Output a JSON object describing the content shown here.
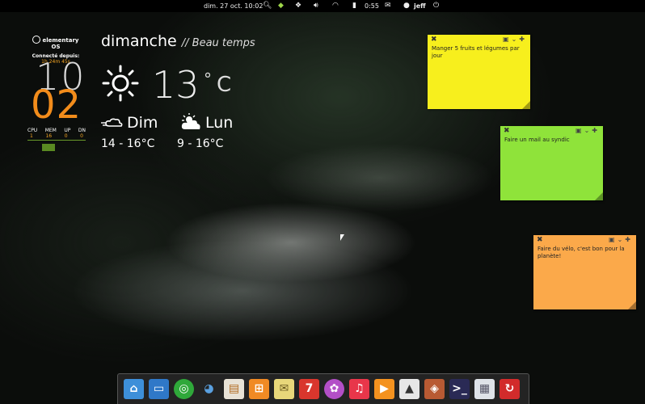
{
  "panel": {
    "datetime": "dim. 27 oct. 10:02",
    "battery_time": "0:55",
    "user": "jeff"
  },
  "conky": {
    "os_name": "elementary OS",
    "connected_label": "Connecté depuis:",
    "uptime": "1h 24m 45s",
    "hour": "10",
    "minute": "02",
    "stats_labels": [
      "CPU",
      "MEM",
      "UP",
      "DN"
    ],
    "stats_values": [
      "1",
      "16",
      "0",
      "0"
    ]
  },
  "weather": {
    "day": "dimanche",
    "condition": "// Beau temps",
    "temperature": "13",
    "degree": "°",
    "unit": "C",
    "forecast": [
      {
        "day": "Dim",
        "range": "14 - 16°C",
        "icon": "wind-icon"
      },
      {
        "day": "Lun",
        "range": "9 - 16°C",
        "icon": "partly-cloudy-icon"
      }
    ]
  },
  "notes": [
    {
      "text": "Manger 5 fruits et légumes par jour",
      "color": "#f7ef1d"
    },
    {
      "text": "Faire un mail au syndic",
      "color": "#8fe33a"
    },
    {
      "text": "Faire du vélo, c'est bon pour la planète!",
      "color": "#fba94a"
    }
  ],
  "dock": {
    "apps": [
      "files-icon",
      "desktop-icon",
      "chrome-icon",
      "pidgin-icon",
      "libreoffice-icon",
      "calculator-icon",
      "mail-icon",
      "calendar-icon",
      "shotwell-icon",
      "music-icon",
      "videos-icon",
      "image-viewer-icon",
      "fox-icon",
      "terminal-icon",
      "switchboard-icon",
      "update-icon"
    ],
    "calendar_day": "7"
  }
}
